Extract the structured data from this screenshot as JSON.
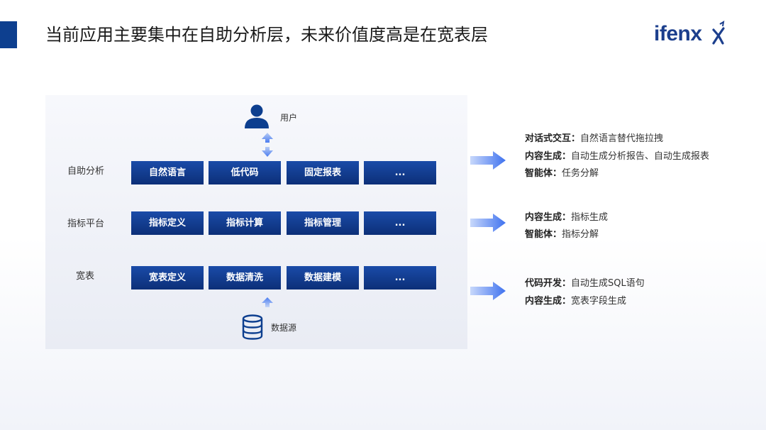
{
  "header": {
    "title": "当前应用主要集中在自助分析层，未来价值度高是在宽表层",
    "logo_text": "ifenx"
  },
  "diagram": {
    "user_label": "用户",
    "datasource_label": "数据源",
    "rows": [
      {
        "label": "自助分析",
        "boxes": [
          "自然语言",
          "低代码",
          "固定报表",
          "..."
        ]
      },
      {
        "label": "指标平台",
        "boxes": [
          "指标定义",
          "指标计算",
          "指标管理",
          "..."
        ]
      },
      {
        "label": "宽表",
        "boxes": [
          "宽表定义",
          "数据清洗",
          "数据建模",
          "..."
        ]
      }
    ]
  },
  "descriptions": [
    [
      {
        "key": "对话式交互",
        "sep": "：",
        "value": "自然语言替代拖拉拽"
      },
      {
        "key": "内容生成",
        "sep": "：",
        "value": "自动生成分析报告、自动生成报表"
      },
      {
        "key": "智能体",
        "sep": "：",
        "value": "任务分解"
      }
    ],
    [
      {
        "key": "内容生成",
        "sep": "：",
        "value": "指标生成"
      },
      {
        "key": "智能体",
        "sep": "：",
        "value": "指标分解"
      }
    ],
    [
      {
        "key": "代码开发",
        "sep": "：",
        "value": "自动生成SQL语句"
      },
      {
        "key": "内容生成",
        "sep": "：",
        "value": "宽表字段生成"
      }
    ]
  ],
  "colors": {
    "accent": "#0d3f8f",
    "box_top": "#1a4ba8",
    "box_bottom": "#0c2f78",
    "arrow": "#4a7cf0",
    "logo": "#1c3f8d"
  },
  "icons": [
    "user-icon",
    "database-icon",
    "double-arrow-icon",
    "up-arrow-icon",
    "right-arrow-icon"
  ]
}
